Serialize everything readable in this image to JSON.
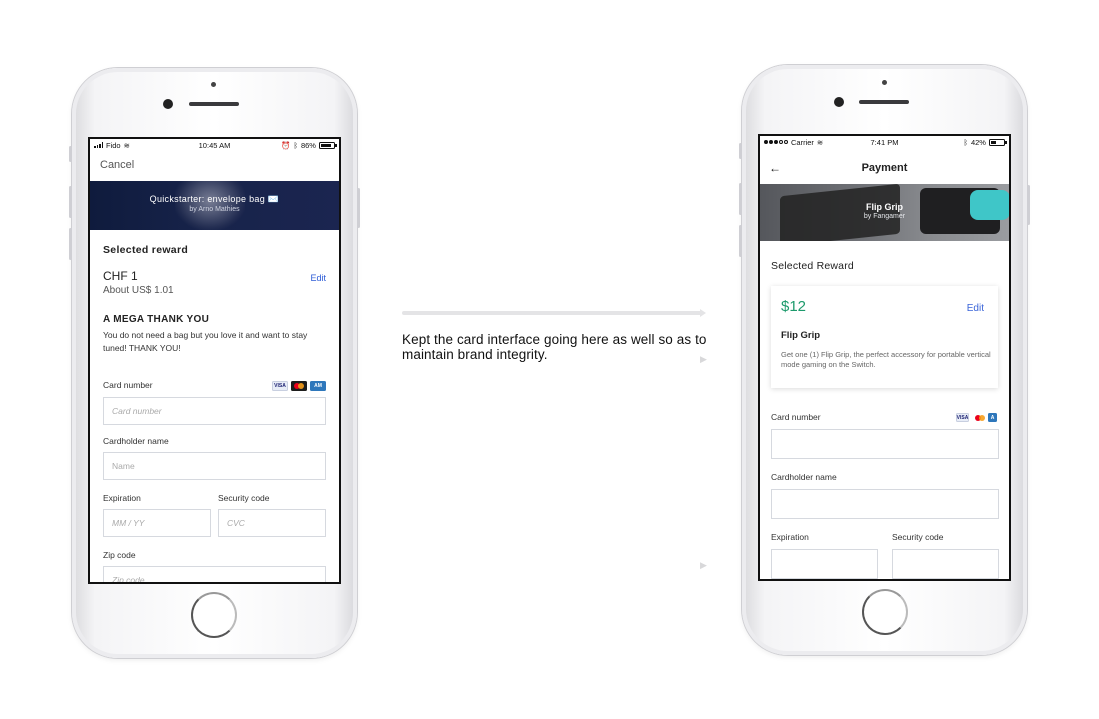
{
  "annotation": {
    "caption": "Kept the card interface going here as well so as to maintain brand integrity."
  },
  "left_phone": {
    "status": {
      "carrier": "Fido",
      "time": "10:45 AM",
      "battery": "86%",
      "battery_level": 0.86
    },
    "cancel_label": "Cancel",
    "banner": {
      "title": "Quickstarter: envelope bag ✉️",
      "subtitle": "by Arno Mathies"
    },
    "selected_reward_label": "Selected reward",
    "amount": "CHF 1",
    "amount_converted": "About US$ 1.01",
    "edit_label": "Edit",
    "reward_title": "A MEGA THANK YOU",
    "reward_description": "You do not need a bag but you love it and want to stay tuned! THANK YOU!",
    "form": {
      "card_number_label": "Card number",
      "card_number_placeholder": "Card number",
      "cardholder_label": "Cardholder name",
      "cardholder_placeholder": "Name",
      "expiration_label": "Expiration",
      "expiration_placeholder": "MM / YY",
      "security_label": "Security code",
      "security_placeholder": "CVC",
      "zip_label": "Zip code",
      "zip_placeholder": "Zip code"
    },
    "card_icons": [
      "visa-icon",
      "mastercard-icon",
      "amex-icon"
    ]
  },
  "right_phone": {
    "status": {
      "carrier": "Carrier",
      "time": "7:41 PM",
      "battery": "42%",
      "battery_level": 0.42
    },
    "nav_title": "Payment",
    "back_icon": "←",
    "banner": {
      "title": "Flip Grip",
      "subtitle": "by Fangamer"
    },
    "selected_reward_label": "Selected Reward",
    "amount": "$12",
    "edit_label": "Edit",
    "reward_title": "Flip Grip",
    "reward_description": "Get one (1) Flip Grip, the perfect accessory for portable vertical mode gaming on the Switch.",
    "form": {
      "card_number_label": "Card number",
      "cardholder_label": "Cardholder name",
      "expiration_label": "Expiration",
      "security_label": "Security code"
    },
    "card_icons": [
      "visa-icon",
      "mastercard-icon",
      "amex-icon"
    ]
  },
  "colors": {
    "left_edit": "#2c5bd6",
    "right_amount": "#1d9a6c",
    "right_edit": "#3a64d8",
    "left_banner": "#15204a"
  }
}
